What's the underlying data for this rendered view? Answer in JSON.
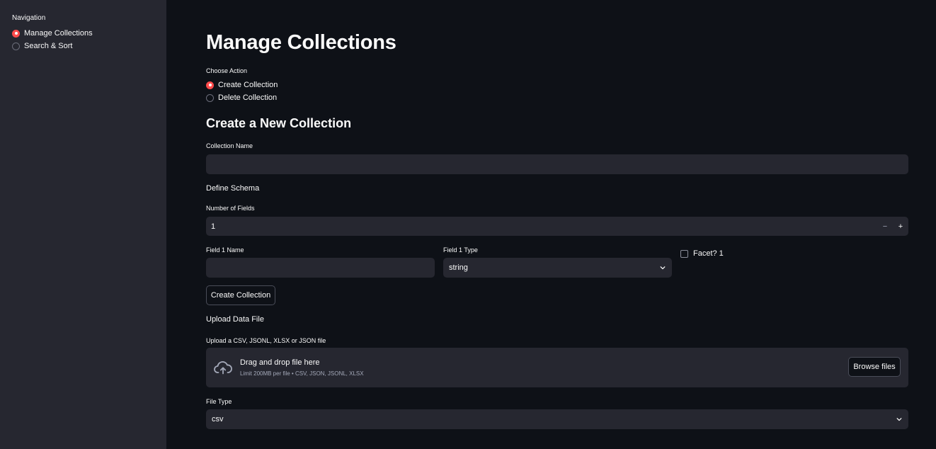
{
  "sidebar": {
    "heading": "Navigation",
    "items": [
      {
        "label": "Manage Collections",
        "selected": true
      },
      {
        "label": "Search & Sort",
        "selected": false
      }
    ]
  },
  "main": {
    "title": "Manage Collections",
    "action": {
      "label": "Choose Action",
      "options": [
        {
          "label": "Create Collection",
          "selected": true
        },
        {
          "label": "Delete Collection",
          "selected": false
        }
      ]
    },
    "create_section": {
      "title": "Create a New Collection",
      "collection_name_label": "Collection Name",
      "collection_name_value": "",
      "schema_heading": "Define Schema",
      "num_fields_label": "Number of Fields",
      "num_fields_value": "1",
      "minus_label": "−",
      "plus_label": "+",
      "field1_name_label": "Field 1 Name",
      "field1_name_value": "",
      "field1_type_label": "Field 1 Type",
      "field1_type_value": "string",
      "facet_label": "Facet? 1",
      "facet_checked": false,
      "create_button_label": "Create Collection"
    },
    "upload_section": {
      "heading": "Upload Data File",
      "uploader_label": "Upload a CSV, JSONL, XLSX or JSON file",
      "dropzone_title": "Drag and drop file here",
      "dropzone_subtitle": "Limit 200MB per file • CSV, JSON, JSONL, XLSX",
      "browse_label": "Browse files",
      "file_type_label": "File Type",
      "file_type_value": "csv"
    }
  },
  "colors": {
    "accent": "#ff4b4b",
    "background": "#0e1117",
    "sidebar_bg": "#262730",
    "input_bg": "#262730"
  },
  "icons": {
    "upload": "cloud-upload-icon",
    "chevron": "chevron-down-icon"
  }
}
